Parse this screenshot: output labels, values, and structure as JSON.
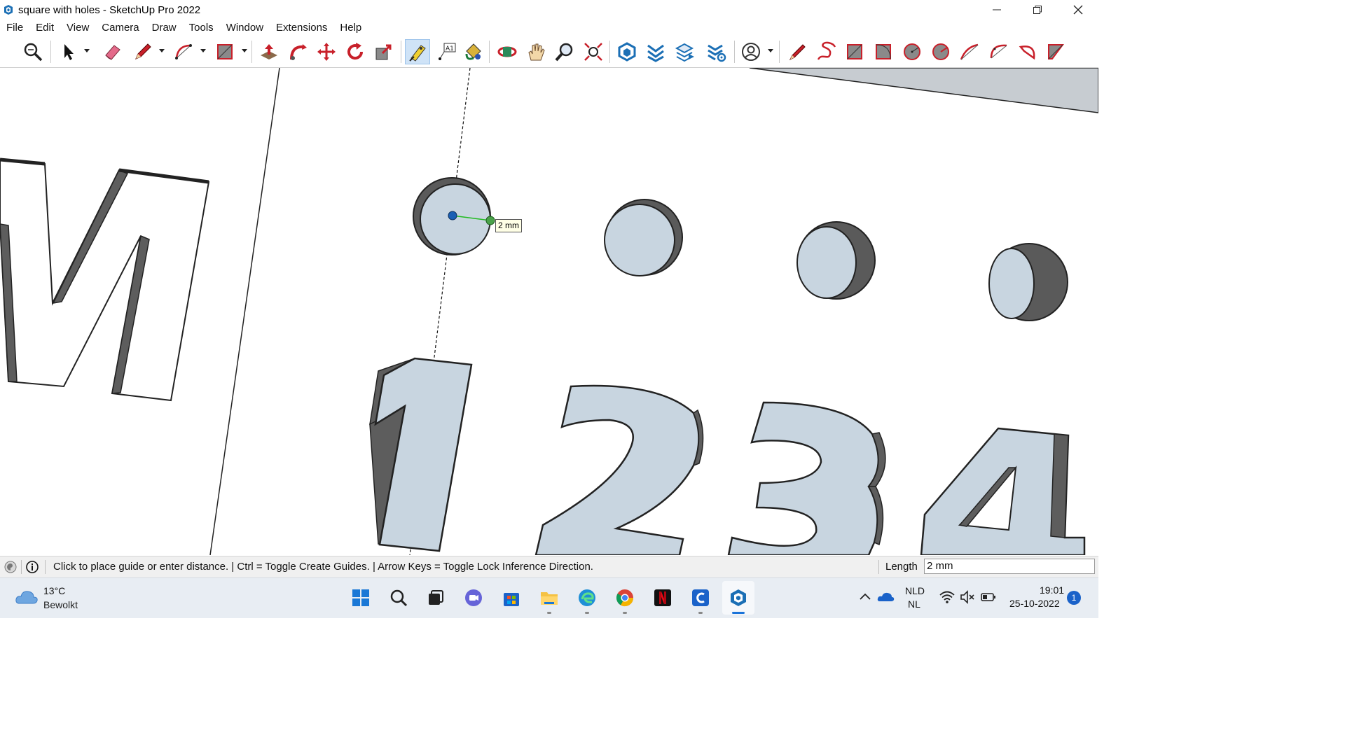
{
  "window": {
    "title": "square with holes - SketchUp Pro 2022",
    "controls": [
      "minimize",
      "restore",
      "close"
    ]
  },
  "menu": [
    "File",
    "Edit",
    "View",
    "Camera",
    "Draw",
    "Tools",
    "Window",
    "Extensions",
    "Help"
  ],
  "toolbar": {
    "tools": [
      "zoom-extents-search",
      "select",
      "eraser",
      "line",
      "arc",
      "rectangle",
      "push-pull",
      "follow-me",
      "move",
      "rotate",
      "scale",
      "tape-measure",
      "text",
      "paint-bucket",
      "orbit",
      "pan",
      "zoom",
      "zoom-extents",
      "warehouse",
      "extension-manager",
      "layers-export",
      "settings-layers",
      "account",
      "pencil",
      "freehand",
      "sandbox-from-contours",
      "sandbox-from-scratch",
      "circle",
      "polygon",
      "arc-2pt",
      "arc-3pt",
      "pie",
      "stamp"
    ],
    "active_tool": "tape-measure"
  },
  "viewport": {
    "measure_tooltip": "2 mm",
    "text_glyphs": [
      "M",
      "1",
      "2",
      "3",
      "4"
    ],
    "hole_count": 4,
    "face_color": "#c8d5e0",
    "side_color": "#606060"
  },
  "status": {
    "message": "Click to place guide or enter distance. | Ctrl = Toggle Create Guides. | Arrow Keys = Toggle Lock Inference Direction.",
    "length_label": "Length",
    "length_value": "2 mm"
  },
  "taskbar": {
    "weather_temp": "13°C",
    "weather_desc": "Bewolkt",
    "apps": [
      "start",
      "search",
      "task-view",
      "teams-chat",
      "store",
      "file-explorer",
      "edge",
      "chrome",
      "netflix",
      "ccleaner",
      "sketchup"
    ],
    "active_app": "sketchup",
    "lang_line1": "NLD",
    "lang_line2": "NL",
    "time": "19:01",
    "date": "25-10-2022",
    "notification_count": "1"
  }
}
